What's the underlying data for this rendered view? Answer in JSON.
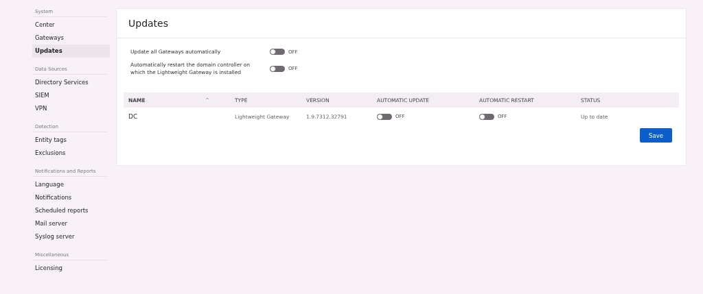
{
  "sidebar": {
    "sections": [
      {
        "heading": "System",
        "items": [
          {
            "label": "Center",
            "selected": false
          },
          {
            "label": "Gateways",
            "selected": false
          },
          {
            "label": "Updates",
            "selected": true
          }
        ]
      },
      {
        "heading": "Data Sources",
        "items": [
          {
            "label": "Directory Services",
            "selected": false
          },
          {
            "label": "SIEM",
            "selected": false
          },
          {
            "label": "VPN",
            "selected": false
          }
        ]
      },
      {
        "heading": "Detection",
        "items": [
          {
            "label": "Entity tags",
            "selected": false
          },
          {
            "label": "Exclusions",
            "selected": false
          }
        ]
      },
      {
        "heading": "Notifications and Reports",
        "items": [
          {
            "label": "Language",
            "selected": false
          },
          {
            "label": "Notifications",
            "selected": false
          },
          {
            "label": "Scheduled reports",
            "selected": false
          },
          {
            "label": "Mail server",
            "selected": false
          },
          {
            "label": "Syslog server",
            "selected": false
          }
        ]
      },
      {
        "heading": "Miscellaneous",
        "items": [
          {
            "label": "Licensing",
            "selected": false
          }
        ]
      }
    ]
  },
  "panel": {
    "title": "Updates",
    "settings": [
      {
        "label": "Update all Gateways automatically",
        "on": false,
        "state_label": "OFF"
      },
      {
        "label": "Automatically restart the domain controller on which the Lightweight Gateway is installed",
        "on": false,
        "state_label": "OFF"
      }
    ],
    "table": {
      "columns": [
        {
          "label": "NAME",
          "sort_icon": "^"
        },
        {
          "label": "TYPE"
        },
        {
          "label": "VERSION"
        },
        {
          "label": "AUTOMATIC UPDATE"
        },
        {
          "label": "AUTOMATIC RESTART"
        },
        {
          "label": "STATUS"
        }
      ],
      "rows": [
        {
          "name": "DC",
          "type": "Lightweight Gateway",
          "version": "1.9.7312.32791",
          "automatic_update": {
            "on": false,
            "state_label": "OFF"
          },
          "automatic_restart": {
            "on": false,
            "state_label": "OFF"
          },
          "status": "Up to date"
        }
      ]
    },
    "save_button": "Save"
  }
}
